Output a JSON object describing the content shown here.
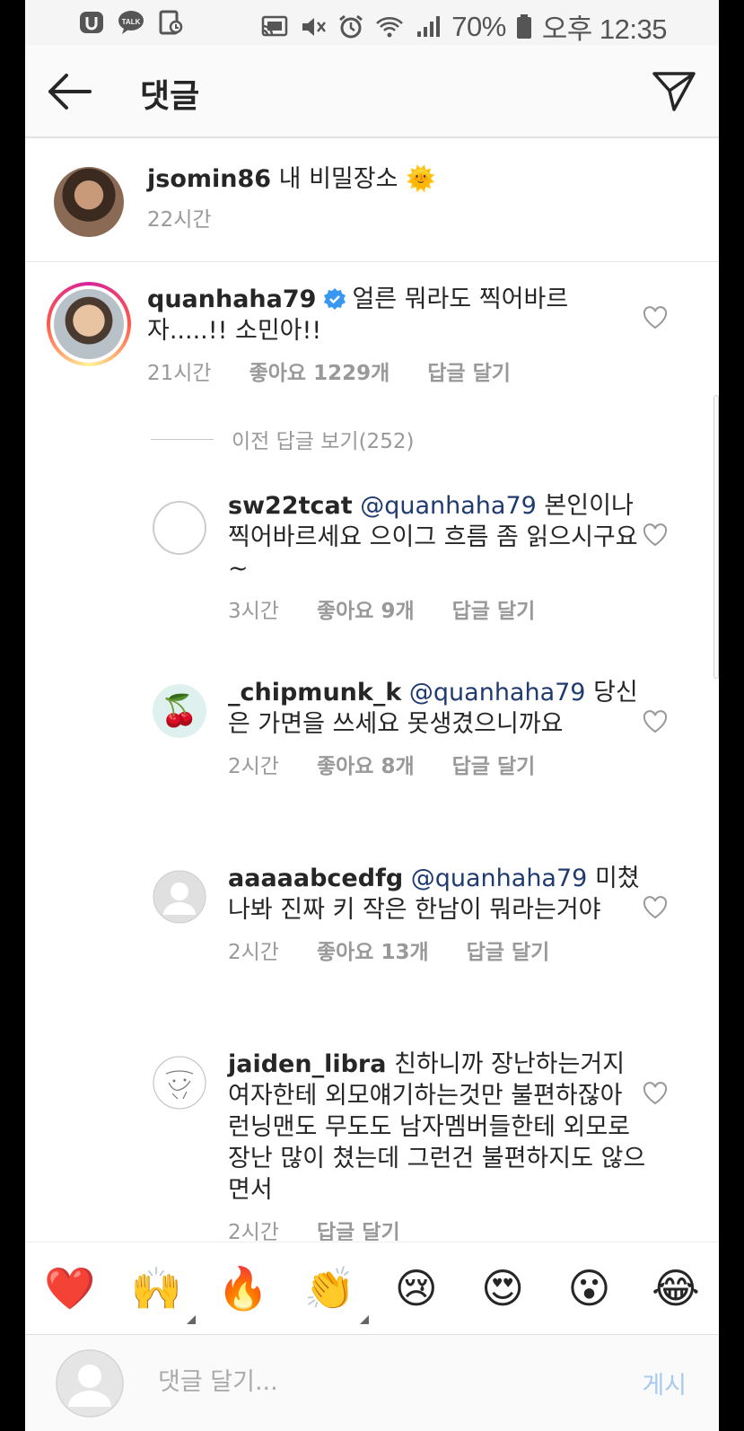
{
  "status_bar": {
    "left_icons": [
      "u-plus-icon",
      "kakaotalk-icon",
      "screenshot-icon"
    ],
    "right_icons": [
      "cast-icon",
      "mute-icon",
      "alarm-icon",
      "wifi-icon",
      "signal-icon",
      "battery-icon"
    ],
    "battery": "70%",
    "time": "오후 12:35"
  },
  "header": {
    "title": "댓글",
    "back_icon": "arrow-left-icon",
    "send_icon": "paper-plane-icon"
  },
  "caption": {
    "username": "jsomin86",
    "text": "내 비밀장소 🌞",
    "time": "22시간"
  },
  "main_comment": {
    "username": "quanhaha79",
    "verified": true,
    "text": "얼른 뭐라도 찍어바르자.....!! 소민아!!",
    "time": "21시간",
    "likes": "좋아요 1229개",
    "reply": "답글 달기"
  },
  "view_previous": "이전 답글 보기(252)",
  "replies": [
    {
      "username": "sw22tcat",
      "mention": "@quanhaha79",
      "text": "본인이나 찍어바르세요 으이그 흐름 좀 읽으시구요~",
      "time": "3시간",
      "likes": "좋아요 9개",
      "reply": "답글 달기",
      "avatar": "empty-circle"
    },
    {
      "username": "_chipmunk_k",
      "mention": "@quanhaha79",
      "text": "당신은 가면을 쓰세요 못생겼으니까요",
      "time": "2시간",
      "likes": "좋아요 8개",
      "reply": "답글 달기",
      "avatar": "cherry-icon"
    },
    {
      "username": "aaaaabcedfg",
      "mention": "@quanhaha79",
      "text": "미쳤나봐 진짜 키 작은 한남이 뭐라는거야",
      "time": "2시간",
      "likes": "좋아요 13개",
      "reply": "답글 달기",
      "avatar": "default-user"
    },
    {
      "username": "jaiden_libra",
      "mention": "",
      "text": "친하니까 장난하는거지 여자한테 외모얘기하는것만 불편하잖아 런닝맨도 무도도 남자멤버들한테 외모로 장난 많이 쳤는데 그런건 불편하지도 않으면서",
      "time": "2시간",
      "likes": "",
      "reply": "답글 달기",
      "avatar": "doodle-sketch"
    }
  ],
  "emoji_bar": [
    "❤️",
    "🙌",
    "🔥",
    "👏",
    "😢",
    "😍",
    "😮",
    "😂"
  ],
  "input": {
    "placeholder": "댓글 달기...",
    "post_label": "게시"
  }
}
